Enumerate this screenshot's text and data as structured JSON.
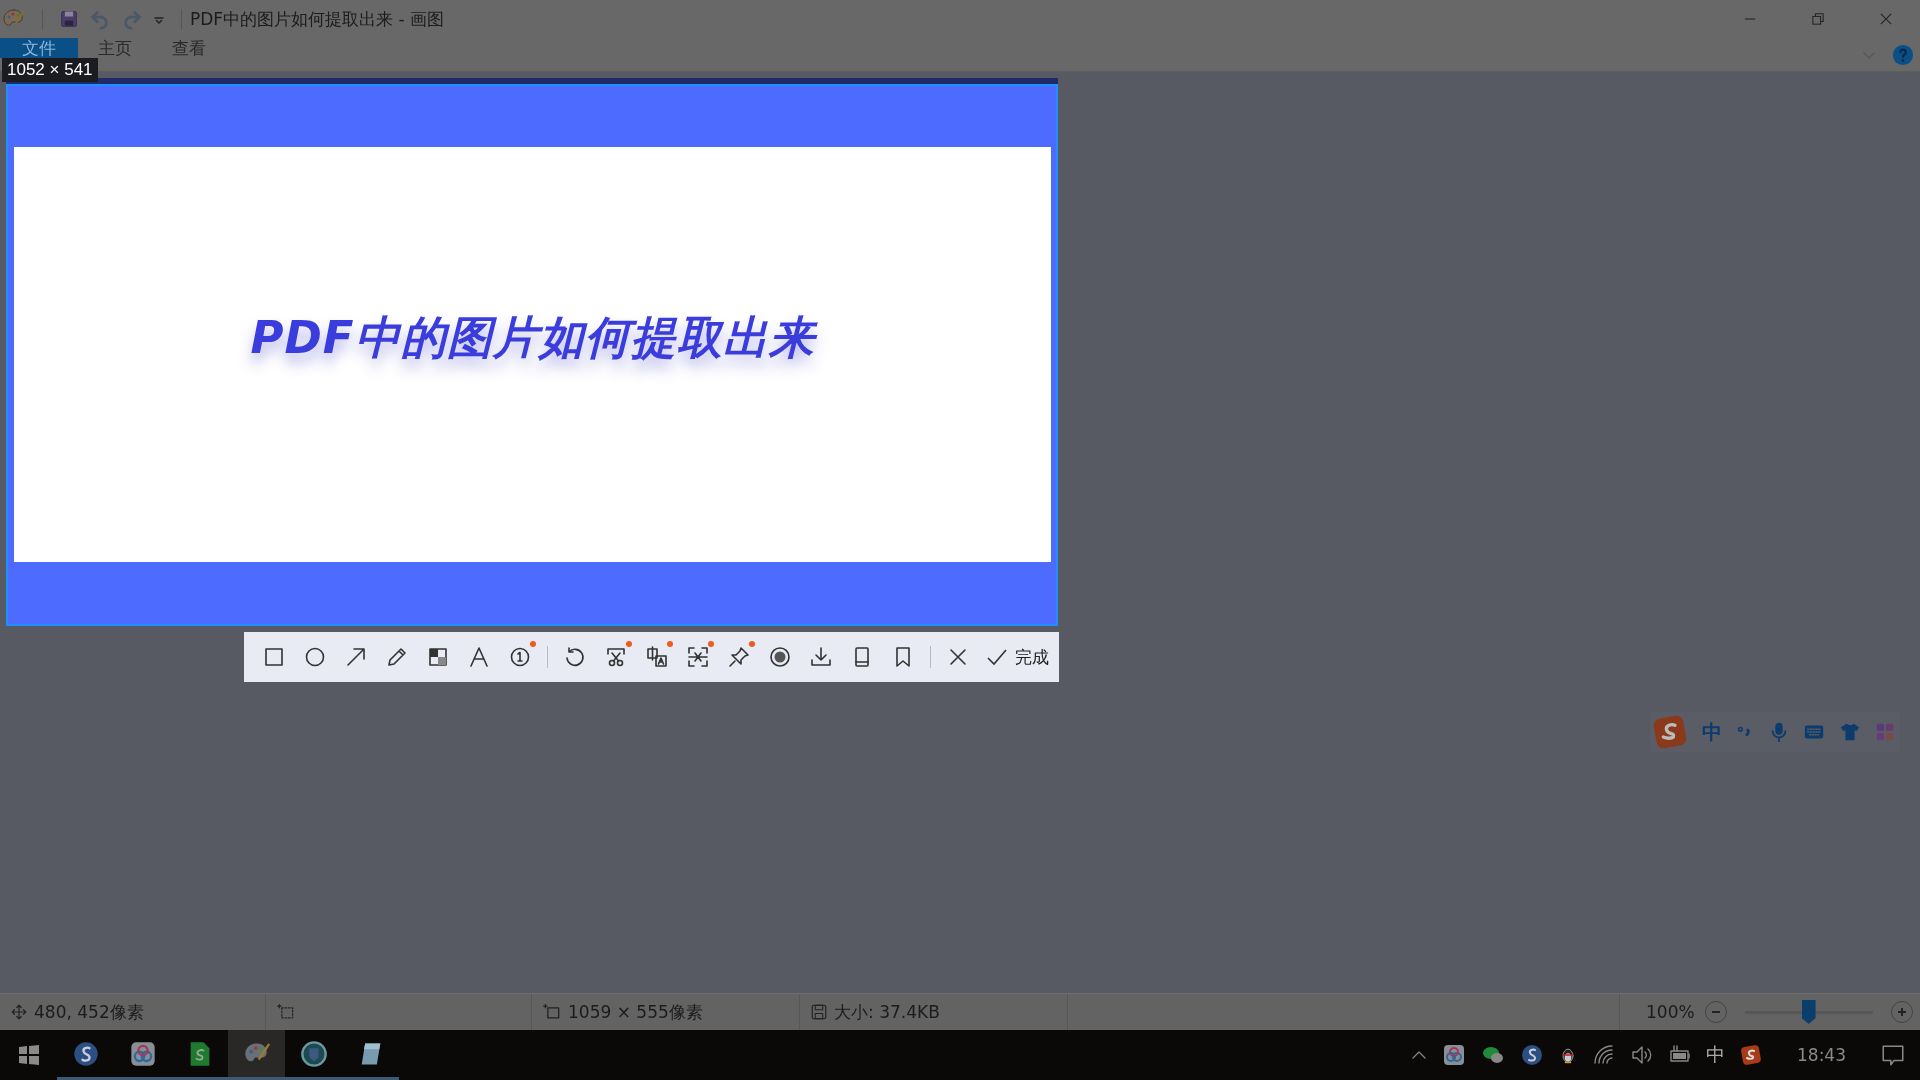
{
  "window": {
    "title": "PDF中的图片如何提取出来 - 画图"
  },
  "ribbon_tabs": [
    {
      "label": "文件",
      "selected": true
    },
    {
      "label": "主页",
      "selected": false
    },
    {
      "label": "查看",
      "selected": false
    }
  ],
  "capture": {
    "size_label": "1052 × 541",
    "image_heading": "PDF中的图片如何提取出来"
  },
  "capture_toolbar": {
    "tools": [
      {
        "kind": "rectangle",
        "badge": false
      },
      {
        "kind": "ellipse",
        "badge": false
      },
      {
        "kind": "arrow",
        "badge": false
      },
      {
        "kind": "pencil",
        "badge": false
      },
      {
        "kind": "mosaic",
        "badge": false
      },
      {
        "kind": "text",
        "badge": false
      },
      {
        "kind": "number",
        "badge": true
      },
      {
        "kind": "separator"
      },
      {
        "kind": "undo",
        "badge": false
      },
      {
        "kind": "scissors",
        "badge": true
      },
      {
        "kind": "translate",
        "badge": true
      },
      {
        "kind": "scan",
        "badge": true
      },
      {
        "kind": "pin",
        "badge": true
      },
      {
        "kind": "record",
        "badge": false
      },
      {
        "kind": "download",
        "badge": false
      },
      {
        "kind": "phone",
        "badge": false
      },
      {
        "kind": "bookmark",
        "badge": false
      },
      {
        "kind": "separator"
      },
      {
        "kind": "close",
        "badge": false
      }
    ],
    "done_label": "完成"
  },
  "ime_bar": {
    "mode": "中"
  },
  "status_bar": {
    "cursor": "480, 452像素",
    "image_size": "1059 × 555像素",
    "file_size": "大小: 37.4KB",
    "zoom": "100%",
    "zoom_level": {
      "level": 0.5
    }
  },
  "taskbar": {
    "apps": [
      {
        "kind": "sogou-browser",
        "selected": false
      },
      {
        "kind": "cloud",
        "selected": false
      },
      {
        "kind": "sheet",
        "selected": false
      },
      {
        "kind": "paint",
        "selected": true
      },
      {
        "kind": "shield",
        "selected": false
      },
      {
        "kind": "notepad",
        "selected": false
      }
    ],
    "ime": "中",
    "time": "18:43"
  }
}
